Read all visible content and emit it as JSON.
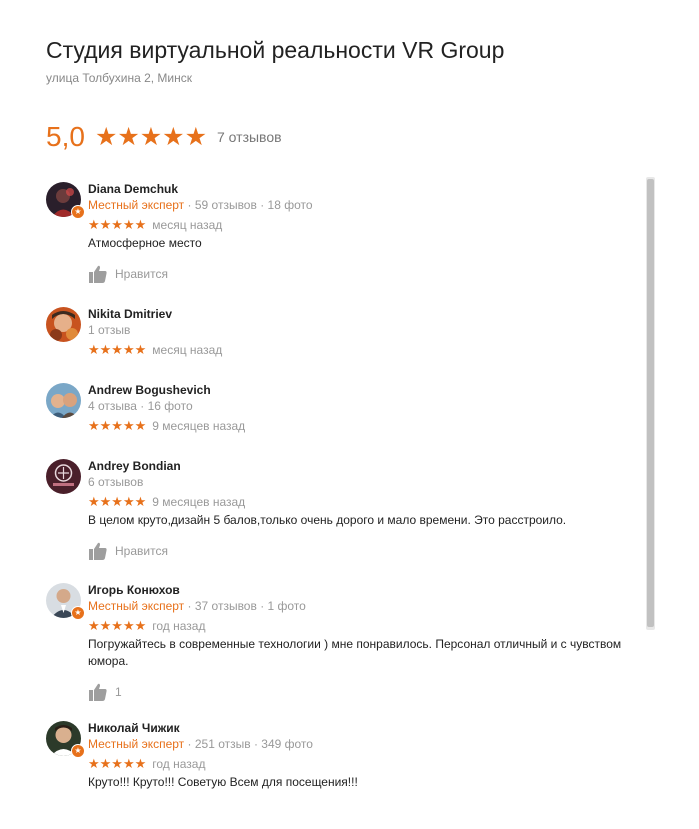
{
  "place": {
    "title": "Студия виртуальной реальности VR Group",
    "address": "улица Толбухина 2, Минск",
    "rating": "5,0",
    "stars": "★★★★★",
    "reviews_count": "7 отзывов"
  },
  "colors": {
    "accent": "#e7711b",
    "muted": "#999999",
    "text": "#222222"
  },
  "reviews": [
    {
      "author": "Diana Demchuk",
      "expert": "Местный эксперт",
      "meta": " · 59 отзывов · 18 фото",
      "stars": "★★★★★",
      "when": "месяц назад",
      "text": "Атмосферное место",
      "like_label": "Нравится"
    },
    {
      "author": "Nikita Dmitriev",
      "expert": "",
      "meta": "1 отзыв",
      "stars": "★★★★★",
      "when": "месяц назад",
      "text": "",
      "like_label": ""
    },
    {
      "author": "Andrew Bogushevich",
      "expert": "",
      "meta": "4 отзыва · 16 фото",
      "stars": "★★★★★",
      "when": "9 месяцев назад",
      "text": "",
      "like_label": ""
    },
    {
      "author": "Andrey Bondian",
      "expert": "",
      "meta": "6 отзывов",
      "stars": "★★★★★",
      "when": "9 месяцев назад",
      "text": "В целом круто,дизайн 5 балов,только очень дорого и мало времени. Это расстроило.",
      "like_label": "Нравится"
    },
    {
      "author": "Игорь Конюхов",
      "expert": "Местный эксперт",
      "meta": " · 37 отзывов · 1 фото",
      "stars": "★★★★★",
      "when": "год назад",
      "text": "Погружайтесь в современные технологии ) мне понравилось. Персонал отличный и с чувством юмора.",
      "like_label": "1"
    },
    {
      "author": "Николай Чижик",
      "expert": "Местный эксперт",
      "meta": " · 251 отзыв · 349 фото",
      "stars": "★★★★★",
      "when": "год назад",
      "text": "Круто!!! Круто!!! Советую Всем для посещения!!!",
      "like_label": ""
    }
  ],
  "icons": {
    "like": "thumbs-up-icon",
    "badge": "local-guide-star-icon"
  }
}
